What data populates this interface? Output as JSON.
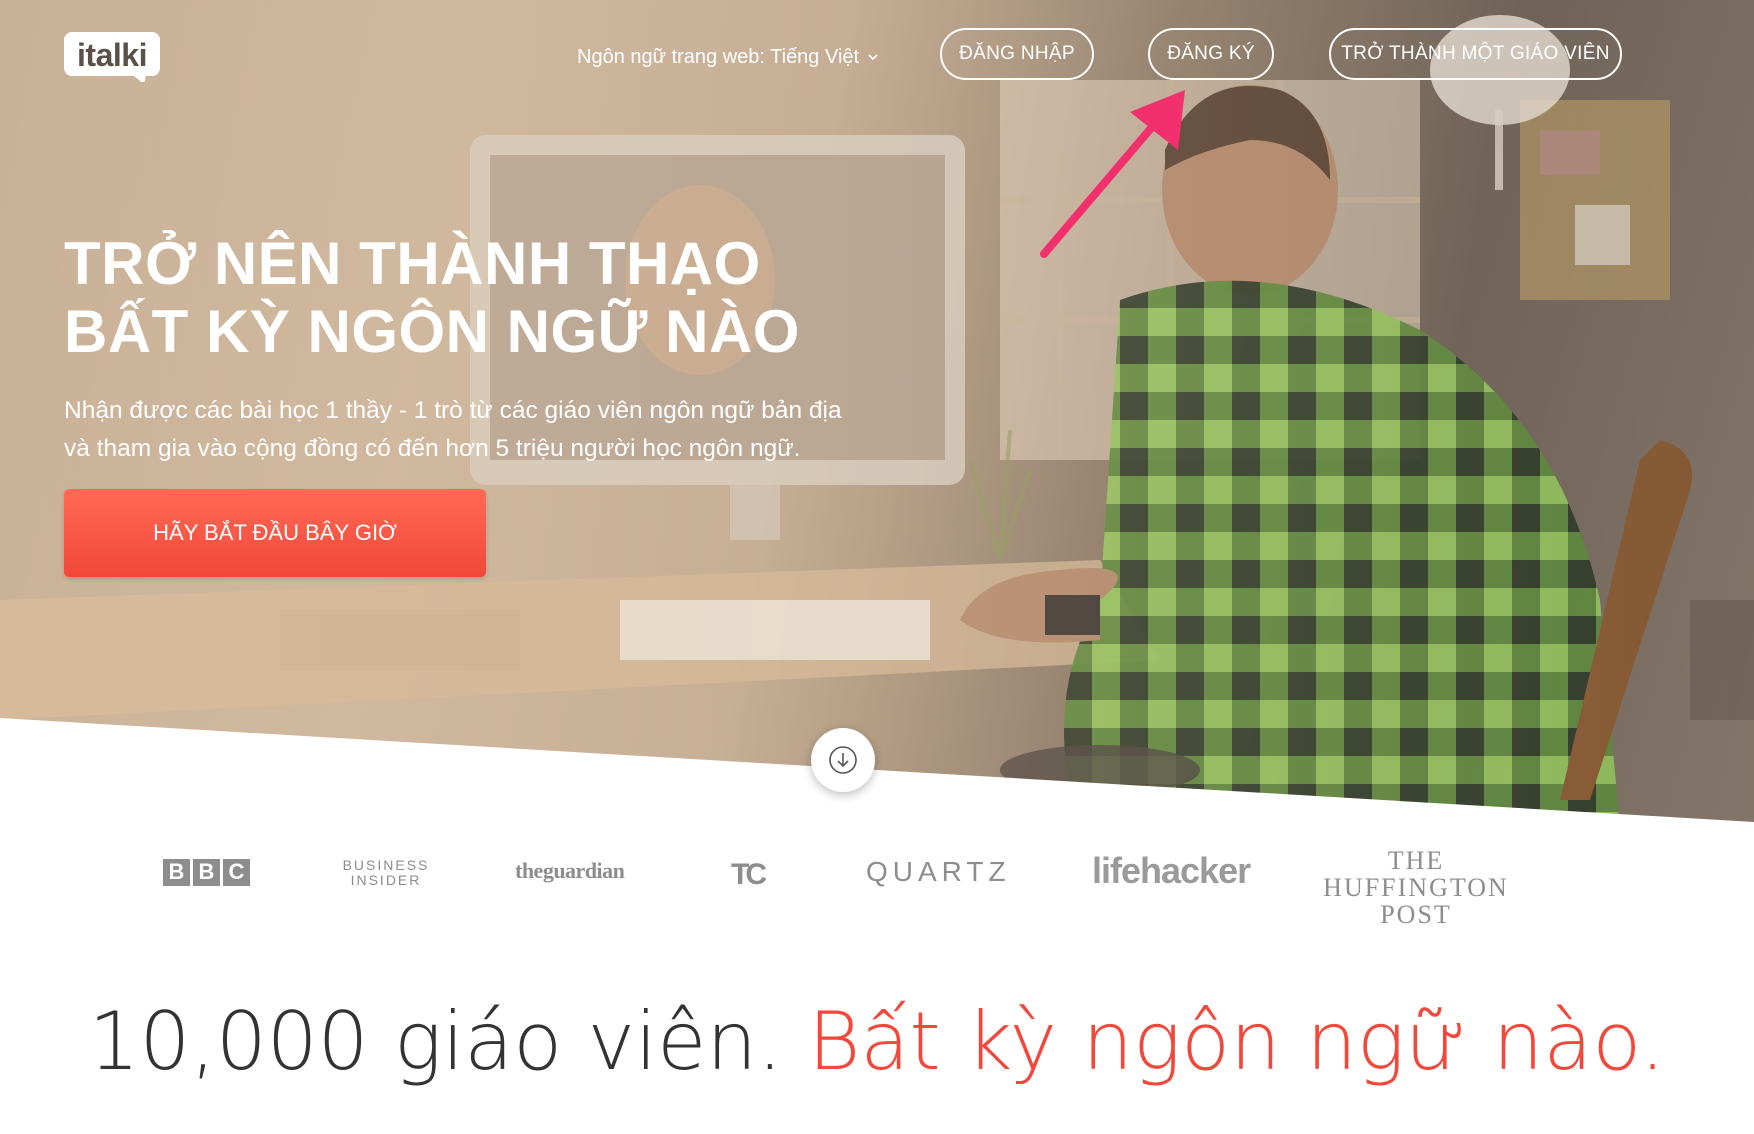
{
  "header": {
    "logo_text": "italki",
    "language_label": "Ngôn ngữ trang web: Tiếng Việt",
    "login_label": "ĐĂNG NHẬP",
    "signup_label": "ĐĂNG KÝ",
    "become_teacher_label": "TRỞ THÀNH MỘT GIÁO VIÊN"
  },
  "hero": {
    "headline_line1": "TRỞ NÊN THÀNH THẠO",
    "headline_line2": "BẤT KỲ NGÔN NGỮ NÀO",
    "subtext_line1": "Nhận được các bài học 1 thầy - 1 trò từ các giáo viên ngôn ngữ bản địa",
    "subtext_line2": "và tham gia vào cộng đồng có đến hơn 5 triệu người học ngôn ngữ.",
    "cta_label": "HÃY BẮT ĐẦU BÂY GIỜ"
  },
  "press": {
    "bbc": [
      "B",
      "B",
      "C"
    ],
    "business_insider_line1": "BUSINESS",
    "business_insider_line2": "INSIDER",
    "guardian": "theguardian",
    "techcrunch": "TC",
    "quartz": "QUARTZ",
    "lifehacker": "lifehacker",
    "huffpost_line1": "THE",
    "huffpost_line2": "HUFFINGTON",
    "huffpost_line3": "POST"
  },
  "tagline": {
    "part1": "10,000 giáo viên.",
    "part2": "Bất kỳ ngôn ngữ nào."
  },
  "colors": {
    "accent_red": "#f2473a",
    "annotation_arrow": "#f2306e"
  },
  "icons": {
    "scroll": "arrow-down-circle-icon",
    "language": "chevron-down-icon"
  }
}
